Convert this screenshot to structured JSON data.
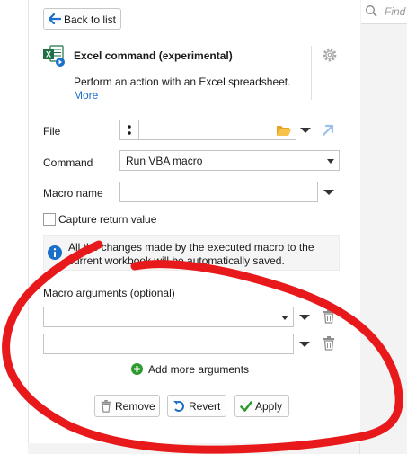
{
  "search": {
    "placeholder": "Find",
    "icon": "search-icon"
  },
  "header": {
    "back_label": "Back to list",
    "back_icon": "arrow-left-icon"
  },
  "command": {
    "icon": "excel-icon",
    "title": "Excel command (experimental)",
    "description": "Perform an action with an Excel spreadsheet.",
    "more_link": "More",
    "settings_icon": "gear-icon"
  },
  "form": {
    "file": {
      "label": "File",
      "value": "",
      "variable_icon": "colon-icon",
      "browse_icon": "folder-icon",
      "link_icon": "arrow-up-right-icon"
    },
    "command": {
      "label": "Command",
      "value": "Run VBA macro"
    },
    "macro_name": {
      "label": "Macro name",
      "value": ""
    },
    "capture": {
      "label": "Capture return value",
      "checked": false
    }
  },
  "info": {
    "icon": "info-icon",
    "text_line1": "All the changes made by the executed macro to the",
    "text_line2": "current workbook will be automatically saved."
  },
  "macro_args": {
    "label": "Macro arguments (optional)",
    "rows": [
      {
        "value": ""
      },
      {
        "value": ""
      }
    ],
    "add_more_label": "Add more arguments"
  },
  "buttons": {
    "remove": "Remove",
    "revert": "Revert",
    "apply": "Apply"
  },
  "colors": {
    "accent": "#1a6fc9",
    "excel_green": "#1e7145",
    "annotation_red": "#e8191b",
    "apply_check": "#2e9a2e"
  }
}
